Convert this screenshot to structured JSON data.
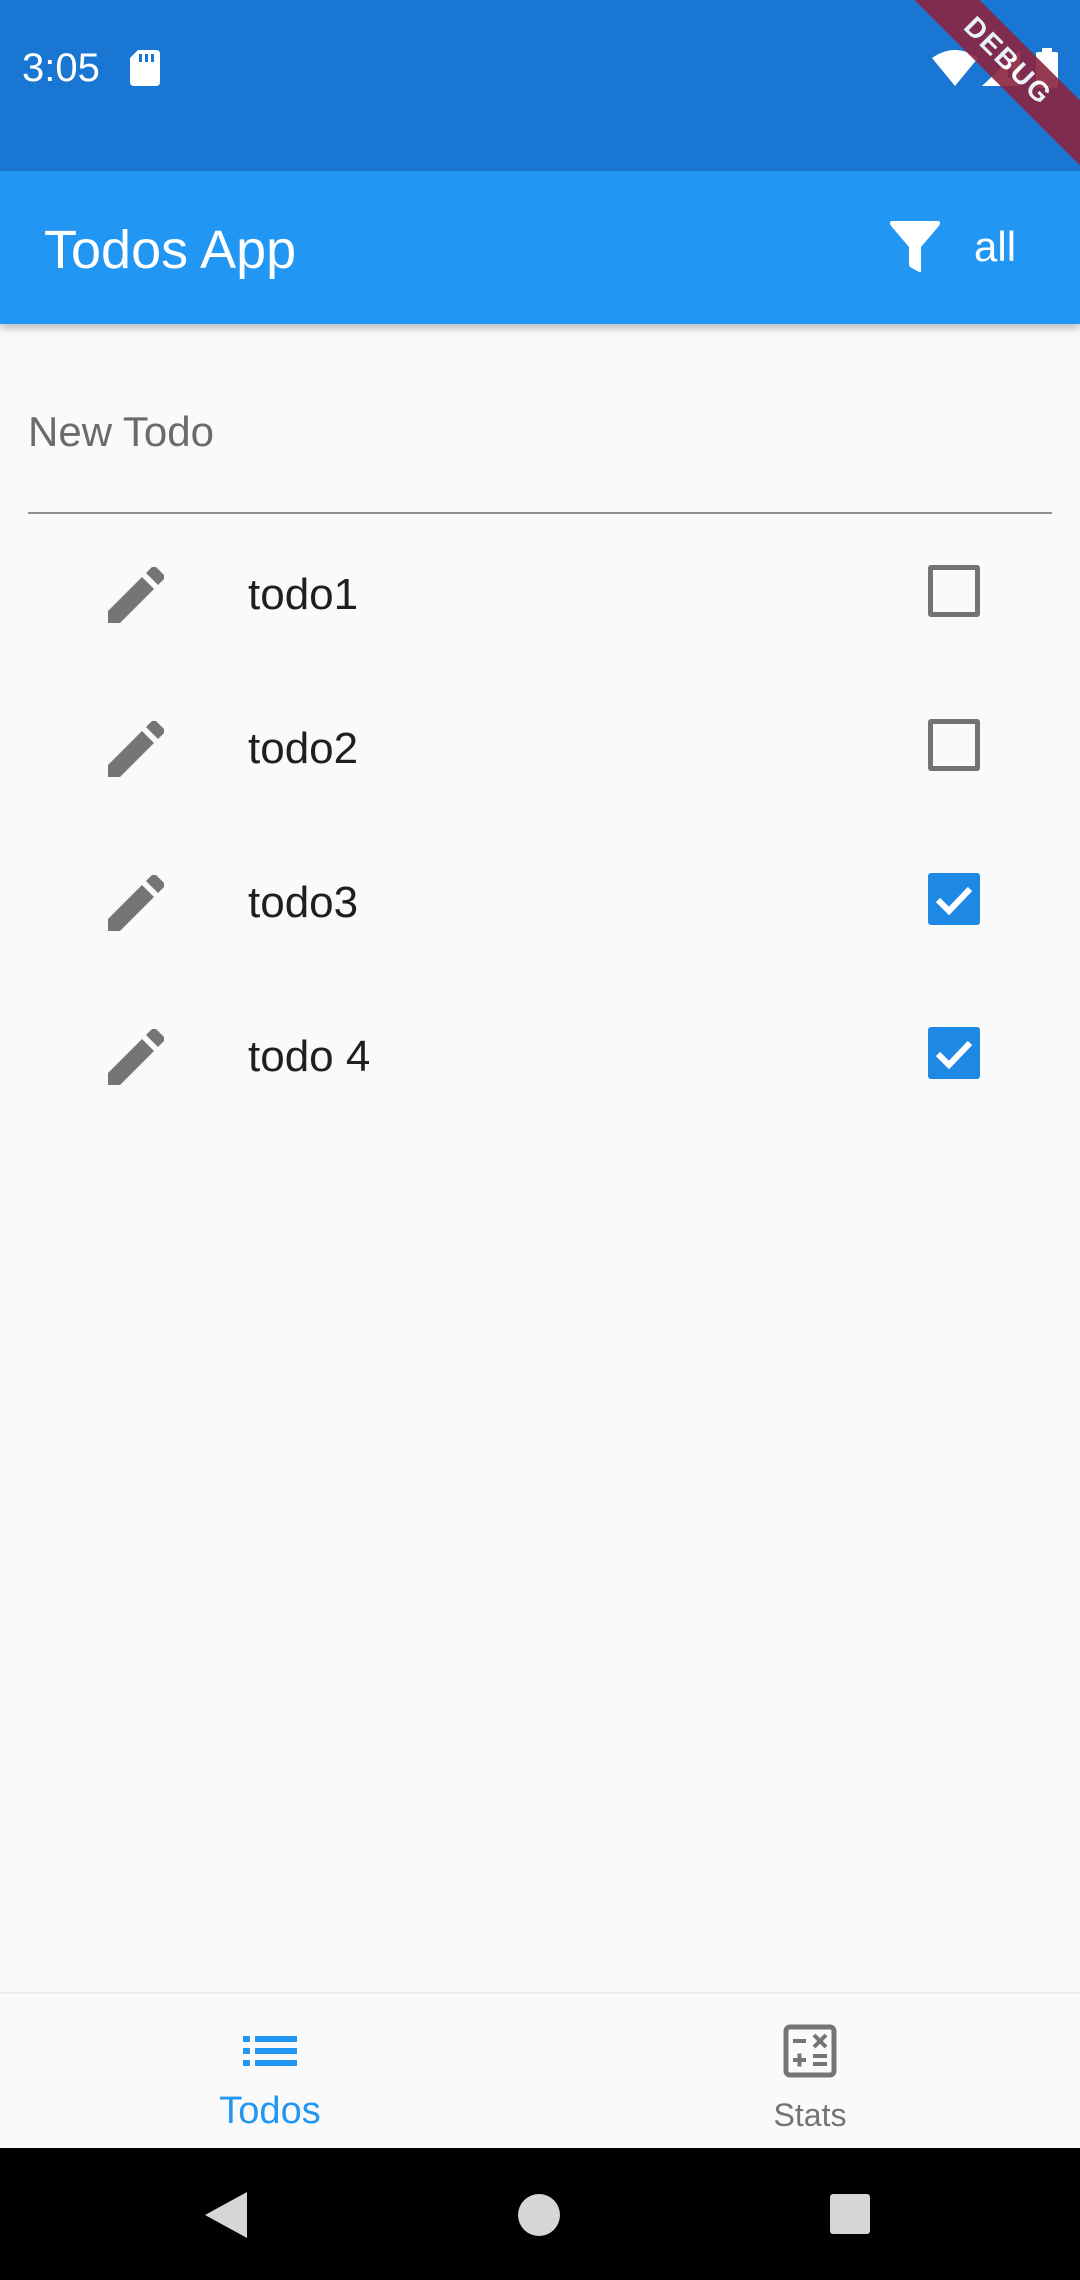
{
  "status_bar": {
    "time": "3:05",
    "debug_banner": "DEBUG"
  },
  "app_bar": {
    "title": "Todos App",
    "filter_label": "all"
  },
  "new_todo": {
    "placeholder": "New Todo",
    "value": ""
  },
  "todos": [
    {
      "label": "todo1",
      "done": false
    },
    {
      "label": "todo2",
      "done": false
    },
    {
      "label": "todo3",
      "done": true
    },
    {
      "label": "todo 4",
      "done": true
    }
  ],
  "bottom_nav": {
    "items": [
      {
        "label": "Todos",
        "icon": "list-icon",
        "active": true
      },
      {
        "label": "Stats",
        "icon": "calculator-icon",
        "active": false
      }
    ]
  },
  "colors": {
    "status_bar": "#1976d2",
    "app_bar": "#2196f3",
    "checkbox_checked": "#1e88e5",
    "nav_active": "#2196f3",
    "nav_inactive": "#757575"
  }
}
